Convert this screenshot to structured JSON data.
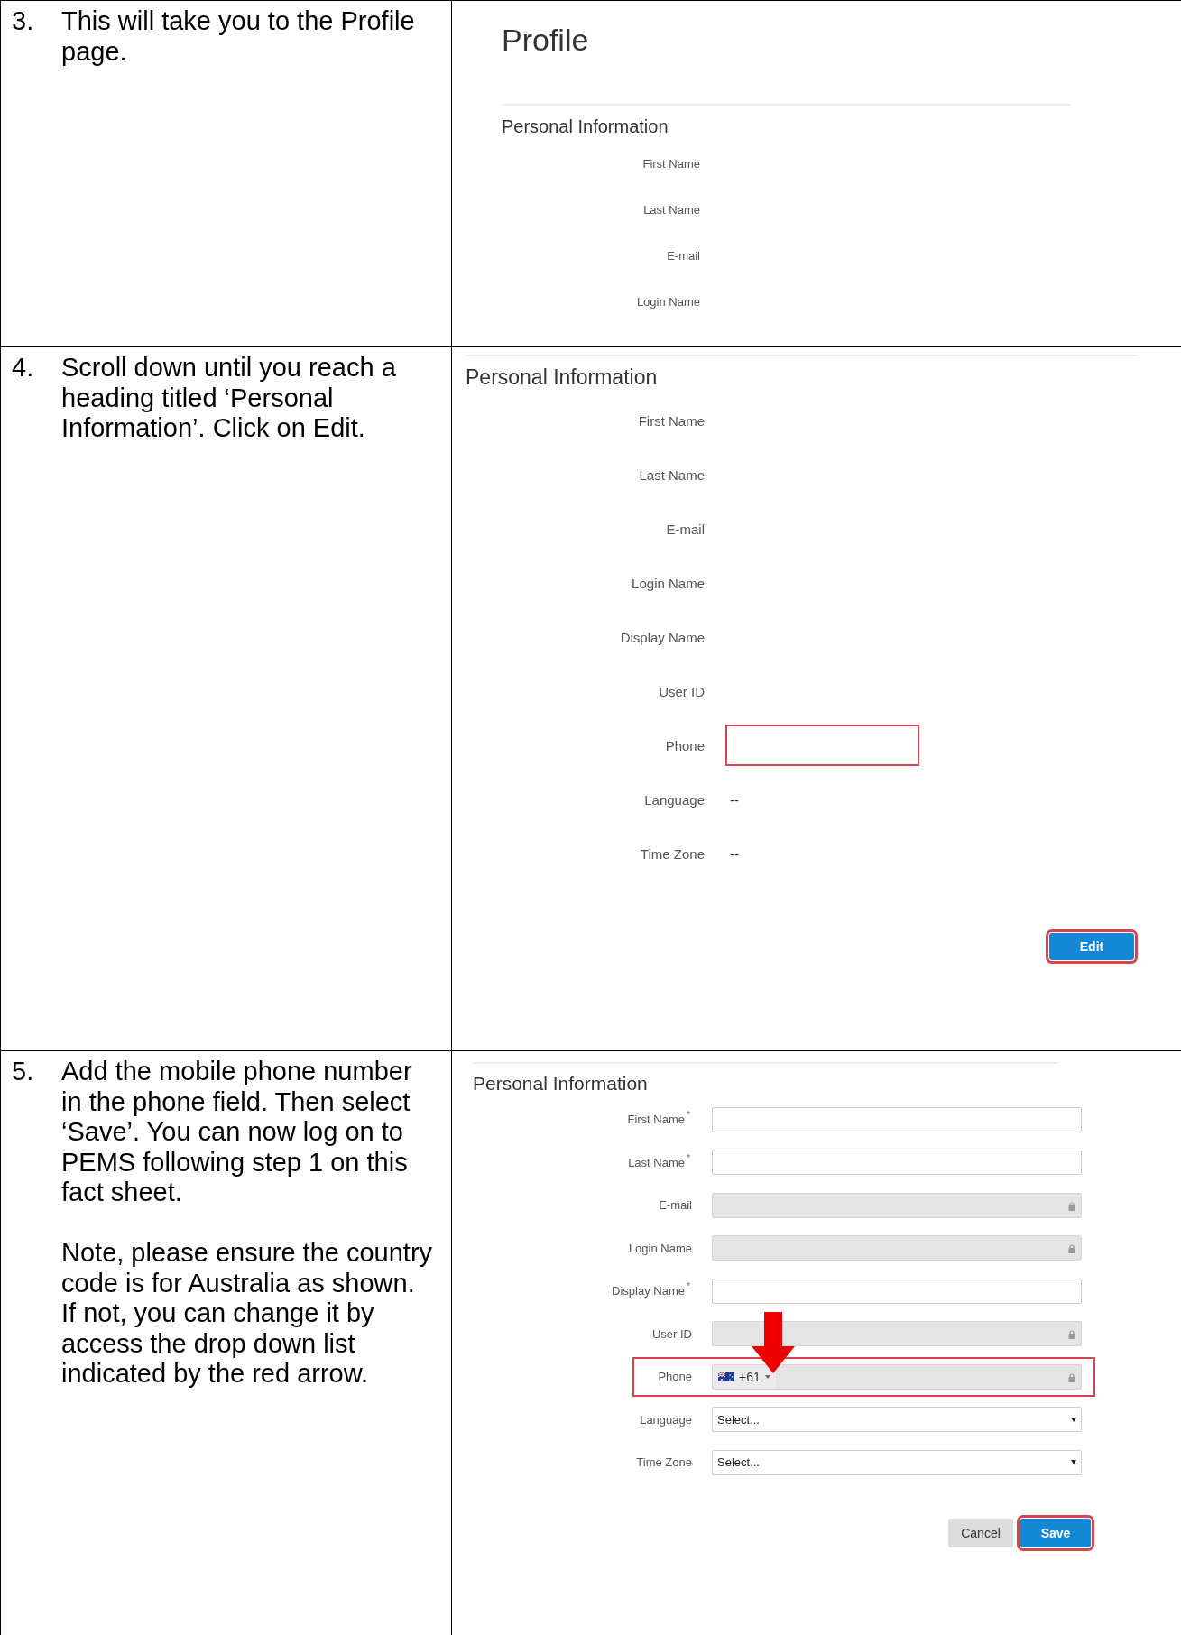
{
  "step_3": {
    "number": "3.",
    "instruction": "This will take you to the Profile page.",
    "screen": {
      "page_title": "Profile",
      "section_title": "Personal Information",
      "fields": [
        {
          "label": "First Name"
        },
        {
          "label": "Last Name"
        },
        {
          "label": "E-mail"
        },
        {
          "label": "Login Name"
        }
      ]
    }
  },
  "step_4": {
    "number": "4.",
    "instruction": "Scroll down until you reach a heading titled ‘Personal Information’. Click on Edit.",
    "screen": {
      "section_title": "Personal Information",
      "fields": [
        {
          "label": "First Name",
          "highlighted": false
        },
        {
          "label": "Last Name",
          "highlighted": false
        },
        {
          "label": "E-mail",
          "highlighted": false
        },
        {
          "label": "Login Name",
          "highlighted": false
        },
        {
          "label": "Display Name",
          "highlighted": false
        },
        {
          "label": "User ID",
          "highlighted": false
        },
        {
          "label": "Phone",
          "highlighted": true
        },
        {
          "label": "Language",
          "value": "--",
          "highlighted": false
        },
        {
          "label": "Time Zone",
          "value": "--",
          "highlighted": false
        }
      ],
      "edit_button": {
        "label": "Edit",
        "highlighted": true
      }
    }
  },
  "step_5": {
    "number": "5.",
    "instruction": [
      "Add the mobile phone number in the phone field. Then select ‘Save’. You can now log on to PEMS following step 1 on this fact sheet.",
      "Note, please ensure the country code is for Australia as shown. If not, you can change it by access the drop down list indicated by the red arrow."
    ],
    "screen": {
      "section_title": "Personal Information",
      "fields": [
        {
          "kind": "text",
          "label": "First Name",
          "required": true,
          "locked": false,
          "highlighted": false
        },
        {
          "kind": "text",
          "label": "Last Name",
          "required": true,
          "locked": false,
          "highlighted": false
        },
        {
          "kind": "text",
          "label": "E-mail",
          "required": false,
          "locked": true,
          "highlighted": false
        },
        {
          "kind": "text",
          "label": "Login Name",
          "required": false,
          "locked": true,
          "highlighted": false
        },
        {
          "kind": "text",
          "label": "Display Name",
          "required": true,
          "locked": false,
          "highlighted": false
        },
        {
          "kind": "text",
          "label": "User ID",
          "required": false,
          "locked": true,
          "highlighted": false
        },
        {
          "kind": "phone",
          "label": "Phone",
          "required": false,
          "locked": true,
          "highlighted": true,
          "country_code": "+61"
        },
        {
          "kind": "select",
          "label": "Language",
          "required": false,
          "highlighted": false,
          "value": "Select..."
        },
        {
          "kind": "select",
          "label": "Time Zone",
          "required": false,
          "highlighted": false,
          "value": "Select..."
        }
      ],
      "required_mark": "*",
      "buttons": [
        {
          "kind": "secondary",
          "label": "Cancel",
          "highlighted": false
        },
        {
          "kind": "primary",
          "label": "Save",
          "highlighted": true
        }
      ]
    }
  }
}
